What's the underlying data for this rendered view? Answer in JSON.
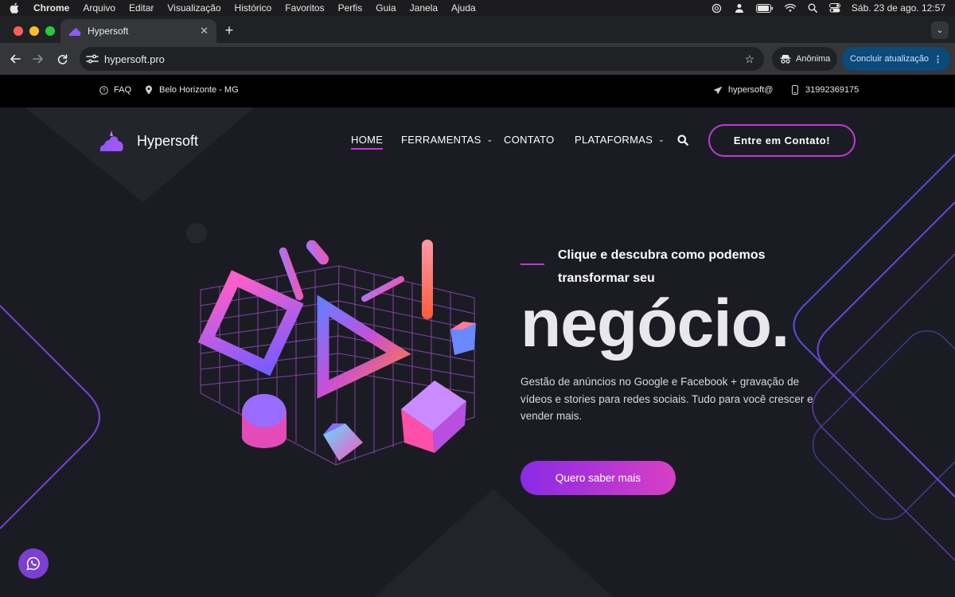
{
  "menubar": {
    "items": [
      "Chrome",
      "Arquivo",
      "Editar",
      "Visualização",
      "Histórico",
      "Favoritos",
      "Perfis",
      "Guia",
      "Janela",
      "Ajuda"
    ],
    "datetime": "Sáb. 23 de ago.  12:57"
  },
  "browser": {
    "tab_title": "Hypersoft",
    "url": "hypersoft.pro",
    "incognito_label": "Anônima",
    "update_label": "Concluir atualização"
  },
  "site": {
    "topbar": {
      "faq": "FAQ",
      "location": "Belo Horizonte - MG",
      "email": "hypersoft@",
      "phone": "31992369175"
    },
    "brand": "Hypersoft",
    "nav": {
      "home": "HOME",
      "tools": "FERRAMENTAS",
      "contact": "CONTATO",
      "platforms": "PLATAFORMAS",
      "cta": "Entre em Contato!"
    },
    "hero": {
      "eyebrow": "Clique e descubra como podemos transformar seu",
      "headline": "negócio.",
      "description": "Gestão de anúncios no Google e Facebook + gravação de vídeos e stories para redes sociais. Tudo para você crescer e vender mais.",
      "cta": "Quero saber mais"
    },
    "colors": {
      "accent": "#c13ad6",
      "gradient_start": "#8a2ae6",
      "gradient_end": "#d83fc4",
      "background": "#1b1c23"
    }
  }
}
